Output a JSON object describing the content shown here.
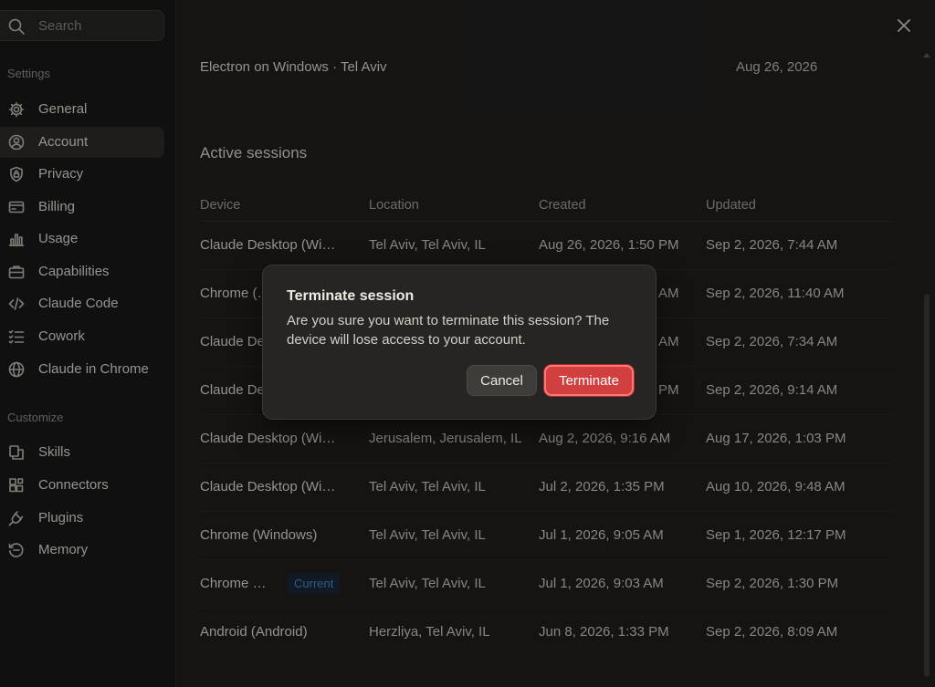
{
  "sidebar": {
    "search_placeholder": "Search",
    "settings_label": "Settings",
    "customize_label": "Customize",
    "settings_items": [
      {
        "label": "General",
        "icon": "gear-icon"
      },
      {
        "label": "Account",
        "icon": "user-circle-icon",
        "active": true
      },
      {
        "label": "Privacy",
        "icon": "shield-icon"
      },
      {
        "label": "Billing",
        "icon": "credit-card-icon"
      },
      {
        "label": "Usage",
        "icon": "bar-chart-icon"
      },
      {
        "label": "Capabilities",
        "icon": "briefcase-icon"
      },
      {
        "label": "Claude Code",
        "icon": "code-icon"
      },
      {
        "label": "Cowork",
        "icon": "checklist-icon"
      },
      {
        "label": "Claude in Chrome",
        "icon": "globe-icon"
      }
    ],
    "customize_items": [
      {
        "label": "Skills",
        "icon": "skills-icon"
      },
      {
        "label": "Connectors",
        "icon": "connectors-icon"
      },
      {
        "label": "Plugins",
        "icon": "plug-icon"
      },
      {
        "label": "Memory",
        "icon": "memory-icon"
      }
    ]
  },
  "main": {
    "previous_row": {
      "device": "Electron on Windows · Tel Aviv",
      "date": "Aug 26, 2026"
    },
    "section_title": "Active sessions",
    "columns": [
      "Device",
      "Location",
      "Created",
      "Updated"
    ],
    "rows": [
      {
        "device": "Claude Desktop (Wi…",
        "location": "Tel Aviv, Tel Aviv, IL",
        "created": "Aug 26, 2026, 1:50 PM",
        "updated": "Sep 2, 2026, 7:44 AM"
      },
      {
        "device": "Chrome (…",
        "location": "",
        "created": "AM",
        "updated": "Sep 2, 2026, 11:40 AM"
      },
      {
        "device": "Claude De…",
        "location": "",
        "created": "AM",
        "updated": "Sep 2, 2026, 7:34 AM"
      },
      {
        "device": "Claude De…",
        "location": "",
        "created": "PM",
        "updated": "Sep 2, 2026, 9:14 AM"
      },
      {
        "device": "Claude Desktop (Wi…",
        "location": "Jerusalem, Jerusalem, IL",
        "created": "Aug 2, 2026, 9:16 AM",
        "updated": "Aug 17, 2026, 1:03 PM"
      },
      {
        "device": "Claude Desktop (Wi…",
        "location": "Tel Aviv, Tel Aviv, IL",
        "created": "Jul 2, 2026, 1:35 PM",
        "updated": "Aug 10, 2026, 9:48 AM"
      },
      {
        "device": "Chrome (Windows)",
        "location": "Tel Aviv, Tel Aviv, IL",
        "created": "Jul 1, 2026, 9:05 AM",
        "updated": "Sep 1, 2026, 12:17 PM"
      },
      {
        "device": "Chrome …",
        "badge": "Current",
        "location": "Tel Aviv, Tel Aviv, IL",
        "created": "Jul 1, 2026, 9:03 AM",
        "updated": "Sep 2, 2026, 1:30 PM"
      },
      {
        "device": "Android (Android)",
        "location": "Herzliya, Tel Aviv, IL",
        "created": "Jun 8, 2026, 1:33 PM",
        "updated": "Sep 2, 2026, 8:09 AM"
      }
    ]
  },
  "dialog": {
    "title": "Terminate session",
    "message": "Are you sure you want to terminate this session? The device will lose access to your account.",
    "cancel_label": "Cancel",
    "confirm_label": "Terminate"
  },
  "colors": {
    "background": "#1f1e1d",
    "sidebar": "#1a1918",
    "accent_danger": "#d1403f",
    "badge_text": "#4b86c6"
  }
}
